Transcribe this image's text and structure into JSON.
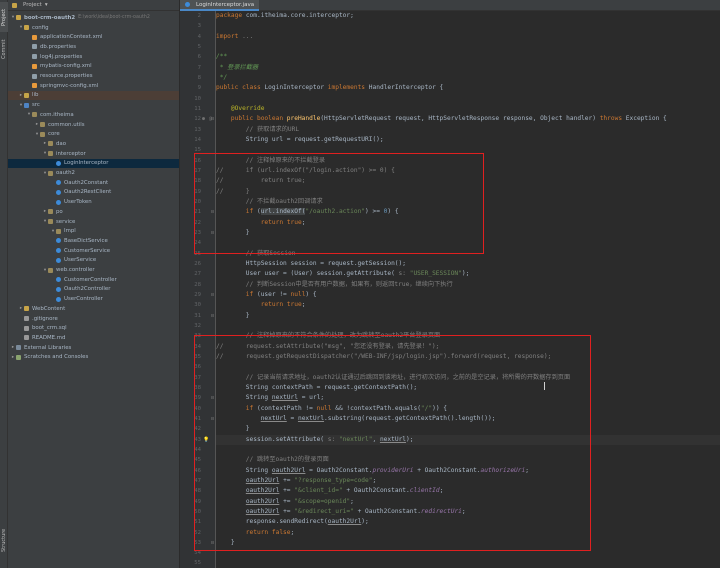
{
  "side_tabs": [
    "Project",
    "Commit",
    "Structure"
  ],
  "project": {
    "title": "Project",
    "dropdown": "▾"
  },
  "tree": [
    {
      "t": "▾",
      "i": "folder",
      "l": "boot-crm-oauth2",
      "p": "E:\\work\\idea\\boot-crm-oauth2",
      "d": 0,
      "b": 1
    },
    {
      "t": "▾",
      "i": "folder",
      "l": "config",
      "d": 1
    },
    {
      "t": "",
      "i": "xml",
      "l": "applicationContext.xml",
      "d": 2
    },
    {
      "t": "",
      "i": "prop",
      "l": "db.properties",
      "d": 2
    },
    {
      "t": "",
      "i": "prop",
      "l": "log4j.properties",
      "d": 2
    },
    {
      "t": "",
      "i": "xml",
      "l": "mybatis-config.xml",
      "d": 2
    },
    {
      "t": "",
      "i": "prop",
      "l": "resource.properties",
      "d": 2
    },
    {
      "t": "",
      "i": "xml",
      "l": "springmvc-config.xml",
      "d": 2
    },
    {
      "t": "▸",
      "i": "folder",
      "l": "lib",
      "d": 1,
      "x": 1
    },
    {
      "t": "▾",
      "i": "src",
      "l": "src",
      "d": 1
    },
    {
      "t": "▾",
      "i": "pkg",
      "l": "com.itheima",
      "d": 2
    },
    {
      "t": "▸",
      "i": "pkg",
      "l": "common.utils",
      "d": 3
    },
    {
      "t": "▾",
      "i": "pkg",
      "l": "core",
      "d": 3
    },
    {
      "t": "▸",
      "i": "pkg",
      "l": "dao",
      "d": 4
    },
    {
      "t": "▾",
      "i": "pkg",
      "l": "interceptor",
      "d": 4
    },
    {
      "t": "",
      "i": "java",
      "l": "LoginInterceptor",
      "d": 5,
      "s": 1
    },
    {
      "t": "▾",
      "i": "pkg",
      "l": "oauth2",
      "d": 4
    },
    {
      "t": "",
      "i": "java",
      "l": "Oauth2Constant",
      "d": 5
    },
    {
      "t": "",
      "i": "java",
      "l": "Oauth2RestClient",
      "d": 5
    },
    {
      "t": "",
      "i": "java",
      "l": "UserToken",
      "d": 5
    },
    {
      "t": "▸",
      "i": "pkg",
      "l": "po",
      "d": 4
    },
    {
      "t": "▾",
      "i": "pkg",
      "l": "service",
      "d": 4
    },
    {
      "t": "▾",
      "i": "pkg",
      "l": "Impl",
      "d": 5
    },
    {
      "t": "",
      "i": "java",
      "l": "BaseDictService",
      "d": 5
    },
    {
      "t": "",
      "i": "java",
      "l": "CustomerService",
      "d": 5
    },
    {
      "t": "",
      "i": "java",
      "l": "UserService",
      "d": 5
    },
    {
      "t": "▾",
      "i": "pkg",
      "l": "web.controller",
      "d": 4
    },
    {
      "t": "",
      "i": "java",
      "l": "CustomerController",
      "d": 5
    },
    {
      "t": "",
      "i": "java",
      "l": "Oauth2Controller",
      "d": 5
    },
    {
      "t": "",
      "i": "java",
      "l": "UserController",
      "d": 5
    },
    {
      "t": "▸",
      "i": "folder",
      "l": "WebContent",
      "d": 1
    },
    {
      "t": "",
      "i": "txt",
      "l": ".gitignore",
      "d": 1
    },
    {
      "t": "",
      "i": "txt",
      "l": "boot_crm.sql",
      "d": 1
    },
    {
      "t": "",
      "i": "txt",
      "l": "README.md",
      "d": 1
    },
    {
      "t": "▸",
      "i": "lib",
      "l": "External Libraries",
      "d": 0
    },
    {
      "t": "▸",
      "i": "scratch",
      "l": "Scratches and Consoles",
      "d": 0
    }
  ],
  "editor": {
    "tab_label": "LoginInterceptor.java",
    "line_numbers": [
      2,
      3,
      4,
      5,
      6,
      7,
      8,
      9,
      10,
      11,
      12,
      13,
      14,
      15,
      16,
      17,
      18,
      19,
      20,
      21,
      22,
      23,
      24,
      25,
      26,
      27,
      28,
      29,
      30,
      31,
      32,
      33,
      34,
      35,
      36,
      37,
      38,
      39,
      40,
      41,
      42,
      43,
      44,
      45,
      46,
      47,
      48,
      49,
      50,
      51,
      52,
      53,
      54,
      55,
      56,
      57
    ],
    "lines": [
      [
        [
          "k",
          "package "
        ],
        [
          "",
          "com.itheima.core.interceptor;"
        ]
      ],
      [],
      [
        [
          "k",
          "import "
        ],
        [
          "c",
          "..."
        ]
      ],
      [],
      [
        [
          "d",
          "/**"
        ]
      ],
      [
        [
          "d",
          " * 登录拦截器"
        ]
      ],
      [
        [
          "d",
          " */"
        ]
      ],
      [
        [
          "k",
          "public class "
        ],
        [
          "",
          "LoginInterceptor "
        ],
        [
          "k",
          "implements "
        ],
        [
          "",
          "HandlerInterceptor {"
        ]
      ],
      [],
      [
        [
          "a",
          "    @Override"
        ]
      ],
      [
        [
          "k",
          "    public boolean "
        ],
        [
          "f",
          "preHandle"
        ],
        [
          "",
          "(HttpServletRequest request, HttpServletResponse response, Object handler) "
        ],
        [
          "k",
          "throws "
        ],
        [
          "",
          "Exception {"
        ]
      ],
      [
        [
          "c",
          "        // 获取请求的URL"
        ]
      ],
      [
        [
          "",
          "        String url = request.getRequestURI();"
        ]
      ],
      [],
      [
        [
          "c",
          "        // 注释掉原来的不拦截登录"
        ]
      ],
      [
        [
          "c",
          "//      "
        ],
        [
          "c",
          "if (url.indexOf(\"/login.action\") >= 0) {"
        ]
      ],
      [
        [
          "c",
          "//          "
        ],
        [
          "c",
          "return true;"
        ]
      ],
      [
        [
          "c",
          "//      "
        ],
        [
          "c",
          "}"
        ]
      ],
      [
        [
          "c",
          "        // 不拦截oauth2回调请求"
        ]
      ],
      [
        [
          "k",
          "        if "
        ],
        [
          "",
          "("
        ],
        [
          "h",
          "url.indexOf("
        ],
        [
          "s",
          "\"/oauth2.action\""
        ],
        [
          "",
          ") >= "
        ],
        [
          "n",
          "0"
        ],
        [
          "",
          ") {"
        ]
      ],
      [
        [
          "k",
          "            return true"
        ],
        [
          "",
          ";"
        ]
      ],
      [
        [
          "",
          "        }"
        ]
      ],
      [],
      [
        [
          "c",
          "        // 获取Session"
        ]
      ],
      [
        [
          "",
          "        HttpSession session = request.getSession();"
        ]
      ],
      [
        [
          "",
          "        User user = (User) session.getAttribute( "
        ],
        [
          "c",
          "s: "
        ],
        [
          "s",
          "\"USER_SESSION\""
        ],
        [
          "",
          ");"
        ]
      ],
      [
        [
          "c",
          "        // 判断Session中是否有用户数据，如果有，则返回true，继续向下执行"
        ]
      ],
      [
        [
          "k",
          "        if "
        ],
        [
          "",
          "(user != "
        ],
        [
          "k",
          "null"
        ],
        [
          "",
          ") {"
        ]
      ],
      [
        [
          "k",
          "            return true"
        ],
        [
          "",
          ";"
        ]
      ],
      [
        [
          "",
          "        }"
        ]
      ],
      [],
      [
        [
          "c",
          "        // 注释掉原来的不符合条件的处理，改为跳转至oauth2平台登录页面"
        ]
      ],
      [
        [
          "c",
          "//      "
        ],
        [
          "c",
          "request.setAttribute(\"msg\", \"您还没有登录，请先登录！\");"
        ]
      ],
      [
        [
          "c",
          "//      "
        ],
        [
          "c",
          "request.getRequestDispatcher(\"/WEB-INF/jsp/login.jsp\").forward(request, response);"
        ]
      ],
      [],
      [
        [
          "c",
          "        // 记录当前请求地址，oauth2认证通过后跳回到该地址，进行初次访问，之前的是空记录，将所需的开数据存到页面"
        ]
      ],
      [
        [
          "",
          "        String contextPath = request.getContextPath();"
        ]
      ],
      [
        [
          "",
          "        String "
        ],
        [
          "u",
          "nextUrl"
        ],
        [
          "",
          " = url;"
        ]
      ],
      [
        [
          "k",
          "        if "
        ],
        [
          "",
          "(contextPath != "
        ],
        [
          "k",
          "null "
        ],
        [
          "",
          "&& !contextPath.equals("
        ],
        [
          "s",
          "\"/\""
        ],
        [
          "",
          ")) {"
        ]
      ],
      [
        [
          "",
          "            "
        ],
        [
          "u",
          "nextUrl"
        ],
        [
          "",
          " = "
        ],
        [
          "u",
          "nextUrl"
        ],
        [
          "",
          ".substring(request.getContextPath().length());"
        ]
      ],
      [
        [
          "",
          "        }"
        ]
      ],
      [
        [
          "",
          "        session.setAttribute( "
        ],
        [
          "c",
          "s: "
        ],
        [
          "s",
          "\"nextUrl\""
        ],
        [
          "",
          ", "
        ],
        [
          "u",
          "nextUrl"
        ],
        [
          "",
          ");"
        ]
      ],
      [],
      [
        [
          "c",
          "        // 跳转至oauth2的登录页面"
        ]
      ],
      [
        [
          "",
          "        String "
        ],
        [
          "u",
          "oauth2Url"
        ],
        [
          "",
          " = Oauth2Constant."
        ],
        [
          "st",
          "providerUri"
        ],
        [
          "",
          " + Oauth2Constant."
        ],
        [
          "st",
          "authorizeUri"
        ],
        [
          "",
          ";"
        ]
      ],
      [
        [
          "",
          "        "
        ],
        [
          "u",
          "oauth2Url"
        ],
        [
          "",
          " += "
        ],
        [
          "s",
          "\"?response_type=code\""
        ],
        [
          "",
          ";"
        ]
      ],
      [
        [
          "",
          "        "
        ],
        [
          "u",
          "oauth2Url"
        ],
        [
          "",
          " += "
        ],
        [
          "s",
          "\"&client_id=\""
        ],
        [
          "",
          " + Oauth2Constant."
        ],
        [
          "st",
          "clientId"
        ],
        [
          "",
          ";"
        ]
      ],
      [
        [
          "",
          "        "
        ],
        [
          "u",
          "oauth2Url"
        ],
        [
          "",
          " += "
        ],
        [
          "s",
          "\"&scope=openid\""
        ],
        [
          "",
          ";"
        ]
      ],
      [
        [
          "",
          "        "
        ],
        [
          "u",
          "oauth2Url"
        ],
        [
          "",
          " += "
        ],
        [
          "s",
          "\"&redirect_uri=\""
        ],
        [
          "",
          " + Oauth2Constant."
        ],
        [
          "st",
          "redirectUri"
        ],
        [
          "",
          ";"
        ]
      ],
      [
        [
          "",
          "        response.sendRedirect("
        ],
        [
          "u",
          "oauth2Url"
        ],
        [
          "",
          ");"
        ]
      ],
      [
        [
          "k",
          "        return false"
        ],
        [
          "",
          ";"
        ]
      ],
      [
        [
          "",
          "    }"
        ]
      ],
      [],
      [],
      [],
      []
    ]
  },
  "colors": {
    "highlight_box": "#e02020",
    "selection": "#0d293e",
    "keyword": "#cc7832",
    "string": "#6a8759",
    "comment": "#808080"
  }
}
